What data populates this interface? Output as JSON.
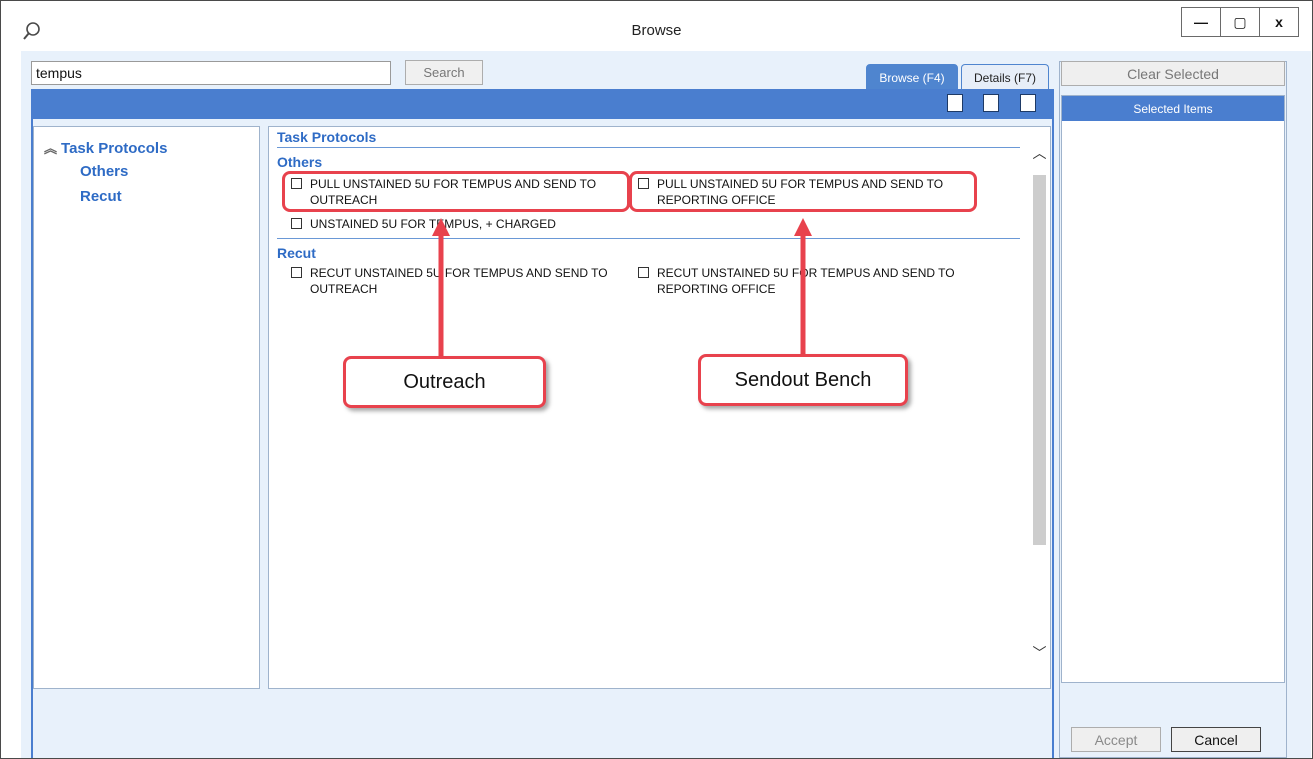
{
  "window": {
    "title": "Browse",
    "minimize_label": "—",
    "maximize_label": "▢",
    "close_label": "x"
  },
  "search": {
    "value": "tempus",
    "button_label": "Search"
  },
  "tabs": [
    {
      "label": "Browse (F4)",
      "active": true
    },
    {
      "label": "Details (F7)",
      "active": false
    }
  ],
  "tree": {
    "root": "Task Protocols",
    "items": [
      "Others",
      "Recut"
    ]
  },
  "results": {
    "header": "Task Protocols",
    "groups": [
      {
        "title": "Others",
        "items": [
          "PULL UNSTAINED 5U FOR TEMPUS AND SEND TO OUTREACH",
          "PULL UNSTAINED 5U FOR TEMPUS AND SEND TO REPORTING OFFICE",
          "UNSTAINED 5U FOR TEMPUS, + CHARGED"
        ]
      },
      {
        "title": "Recut",
        "items": [
          "RECUT UNSTAINED 5U FOR TEMPUS AND SEND TO OUTREACH",
          "RECUT UNSTAINED 5U FOR TEMPUS AND SEND TO REPORTING OFFICE"
        ]
      }
    ]
  },
  "right_panel": {
    "clear_label": "Clear Selected",
    "selected_header": "Selected Items",
    "accept_label": "Accept",
    "cancel_label": "Cancel"
  },
  "annotations": {
    "outreach": "Outreach",
    "sendout": "Sendout Bench",
    "color": "#e8424d"
  },
  "colors": {
    "accent_blue": "#4a7ecf",
    "link_blue": "#2e6bc5"
  }
}
